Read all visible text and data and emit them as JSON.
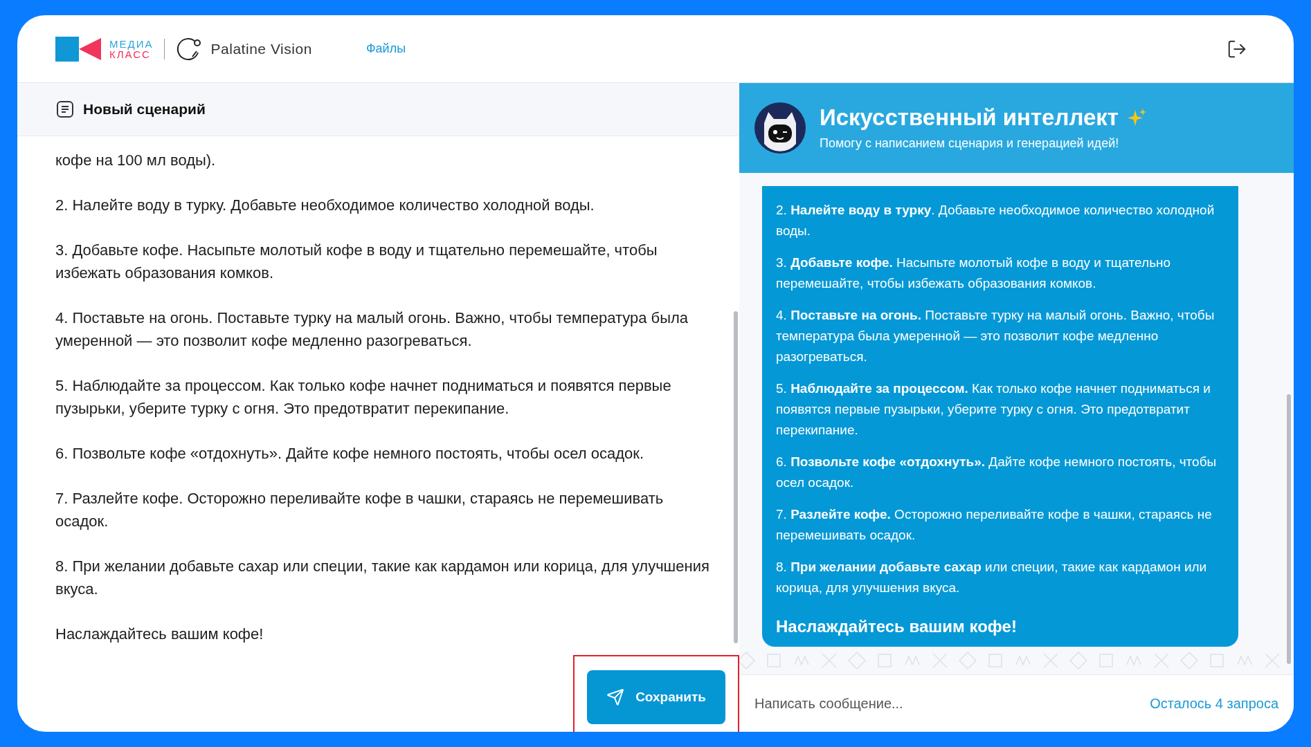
{
  "header": {
    "logo_top": "МЕДИА",
    "logo_bottom": "КЛАСС",
    "brand": "Palatine Vision",
    "nav": [
      {
        "label": "Файлы",
        "selected": true
      }
    ]
  },
  "editor": {
    "title": "Новый сценарий",
    "paragraphs": [
      "кофе на 100 мл воды).",
      "2. Налейте воду в турку. Добавьте необходимое количество холодной воды.",
      "3. Добавьте кофе. Насыпьте молотый кофе в воду и тщательно перемешайте, чтобы избежать образования комков.",
      "4. Поставьте на огонь. Поставьте турку на малый огонь. Важно, чтобы температура была умеренной — это позволит кофе медленно разогреваться.",
      "5. Наблюдайте за процессом. Как только кофе начнет подниматься и появятся первые пузырьки, уберите турку с огня. Это предотвратит перекипание.",
      "6. Позвольте кофе «отдохнуть». Дайте кофе немного постоять, чтобы осел осадок.",
      "7. Разлейте кофе. Осторожно переливайте кофе в чашки, стараясь не перемешивать осадок.",
      "8. При желании добавьте сахар или специи, такие как кардамон или корица, для улучшения вкуса.",
      "Наслаждайтесь вашим кофе!"
    ],
    "save_button": {
      "label": "Сохранить",
      "highlighted": true
    }
  },
  "assistant": {
    "title": "Искусственный интеллект",
    "subtitle": "Помогу с написанием сценария и генерацией идей!",
    "message": {
      "paragraphs": [
        "2. **Налейте воду в турку**. Добавьте необходимое количество холодной воды.",
        "3. **Добавьте кофе.** Насыпьте молотый кофе в воду и тщательно перемешайте, чтобы избежать образования комков.",
        "4. **Поставьте на огонь.** Поставьте турку на малый огонь. Важно, чтобы температура была умеренной — это позволит кофе медленно разогреваться.",
        "5. **Наблюдайте за процессом.** Как только кофе начнет подниматься и появятся первые пузырьки, уберите турку с огня. Это предотвратит перекипание.",
        "6. **Позвольте кофе «отдохнуть».** Дайте кофе немного постоять, чтобы осел осадок.",
        "7. **Разлейте кофе.** Осторожно переливайте кофе в чашки, стараясь не перемешивать осадок.",
        "8. **При желании добавьте сахар** или специи, такие как кардамон или корица, для улучшения вкуса."
      ],
      "closing": "Наслаждайтесь вашим кофе!"
    },
    "input": {
      "placeholder": "Написать сообщение..."
    },
    "remaining": "Осталось 4 запроса"
  }
}
